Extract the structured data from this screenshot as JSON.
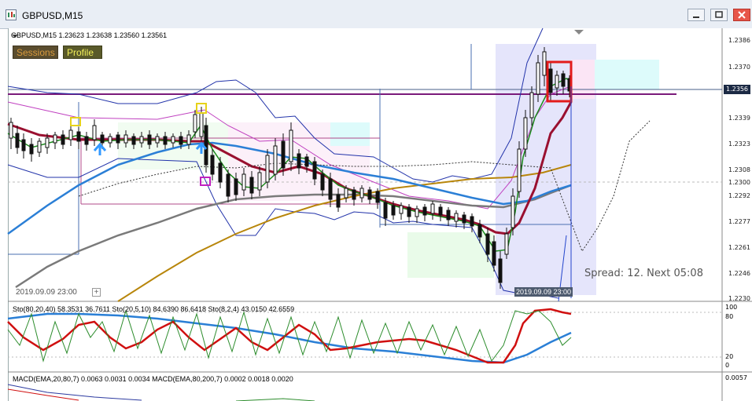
{
  "window": {
    "title": "GBPUSD,M15"
  },
  "chart": {
    "info_line": "GBPUSD,M15  1.23623 1.23638 1.23560 1.23561",
    "sessions_label": "Sessions",
    "profile_label": "Profile",
    "price_axis": [
      "1.2386",
      "1.2370",
      "1.2356",
      "1.2339",
      "1.2323",
      "1.2308",
      "1.2300",
      "1.2292",
      "1.2277",
      "1.2261",
      "1.2246",
      "1.2230"
    ],
    "current_price": "1.2356",
    "spread_text": "Spread: 12. Next 05:08",
    "time_label_left": "2019.09.09 23:00",
    "time_label_cursor": "2019.09.09 23:00",
    "plus_label": "+"
  },
  "stoch_panel": {
    "legend": "Sto(80,20,40) 58.3531 36.7611  Sto(20,5,10) 84.6390 86.6418  Sto(8,2,4) 43.0150 42.6559",
    "levels": [
      "100",
      "80",
      "20",
      "0"
    ]
  },
  "macd_panel": {
    "legend": "MACD(EMA,20,80,7) 0.0063 0.0031 0.0034  MACD(EMA,80,200,7) 0.0002 0.0018 0.0020",
    "level": "0.0057"
  }
}
